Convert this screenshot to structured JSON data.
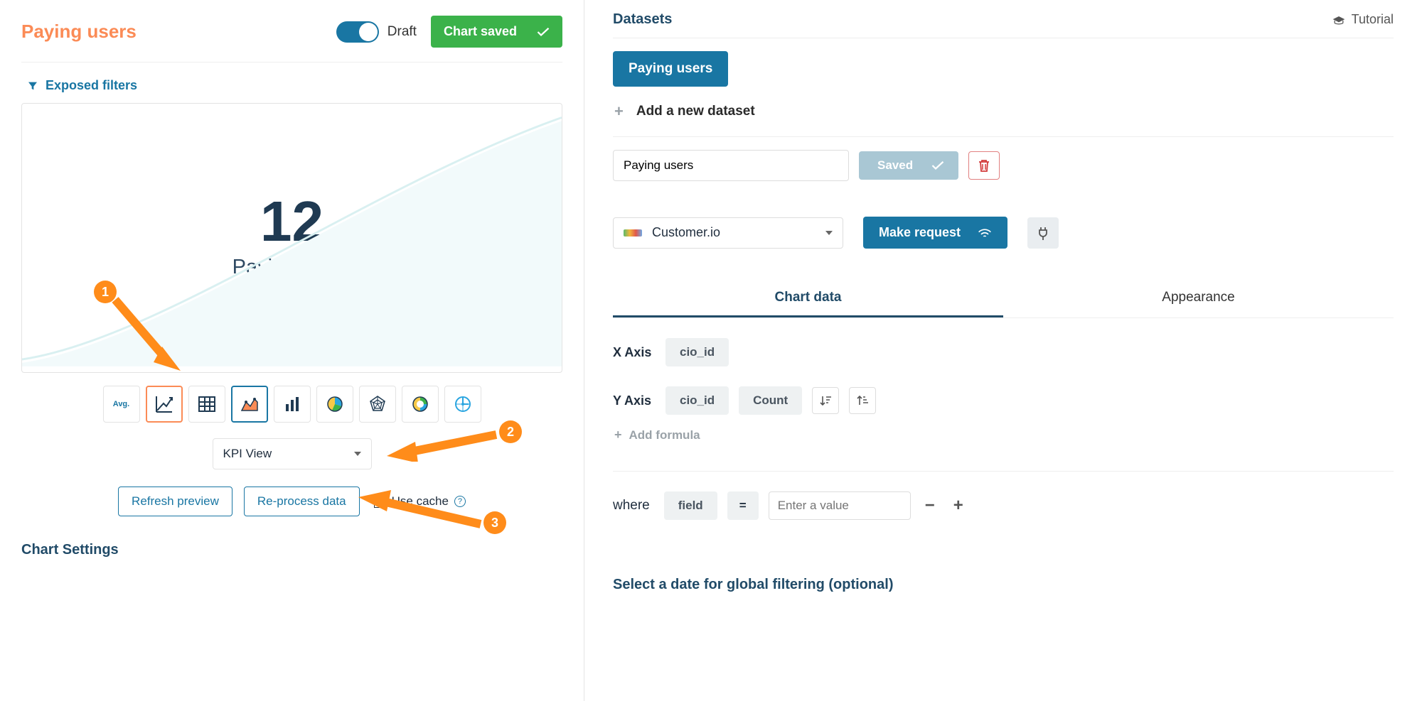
{
  "header": {
    "chart_title": "Paying users",
    "draft_label": "Draft",
    "saved_button": "Chart saved"
  },
  "exposed_filters_label": "Exposed filters",
  "kpi": {
    "value": "12",
    "label": "Paying users"
  },
  "chart_types": [
    {
      "name": "avg",
      "label": "Avg."
    },
    {
      "name": "kpi-trend"
    },
    {
      "name": "table"
    },
    {
      "name": "area"
    },
    {
      "name": "bar"
    },
    {
      "name": "pie"
    },
    {
      "name": "radar"
    },
    {
      "name": "donut"
    },
    {
      "name": "gauge"
    }
  ],
  "view_select": "KPI View",
  "actions": {
    "refresh": "Refresh preview",
    "reprocess": "Re-process data",
    "use_cache": "Use cache"
  },
  "chart_settings_heading": "Chart Settings",
  "callouts": {
    "c1": "1",
    "c2": "2",
    "c3": "3"
  },
  "right": {
    "datasets_heading": "Datasets",
    "tutorial": "Tutorial",
    "active_dataset": "Paying users",
    "add_dataset": "Add a new dataset",
    "dataset_name_value": "Paying users",
    "saved_label": "Saved",
    "source_name": "Customer.io",
    "make_request": "Make request",
    "tabs": {
      "chart_data": "Chart data",
      "appearance": "Appearance"
    },
    "x_axis_label": "X Axis",
    "x_axis_chip": "cio_id",
    "y_axis_label": "Y Axis",
    "y_axis_chip1": "cio_id",
    "y_axis_chip2": "Count",
    "add_formula": "Add formula",
    "where_label": "where",
    "where_field": "field",
    "where_op": "=",
    "where_placeholder": "Enter a value",
    "global_filter_heading": "Select a date for global filtering (optional)"
  }
}
